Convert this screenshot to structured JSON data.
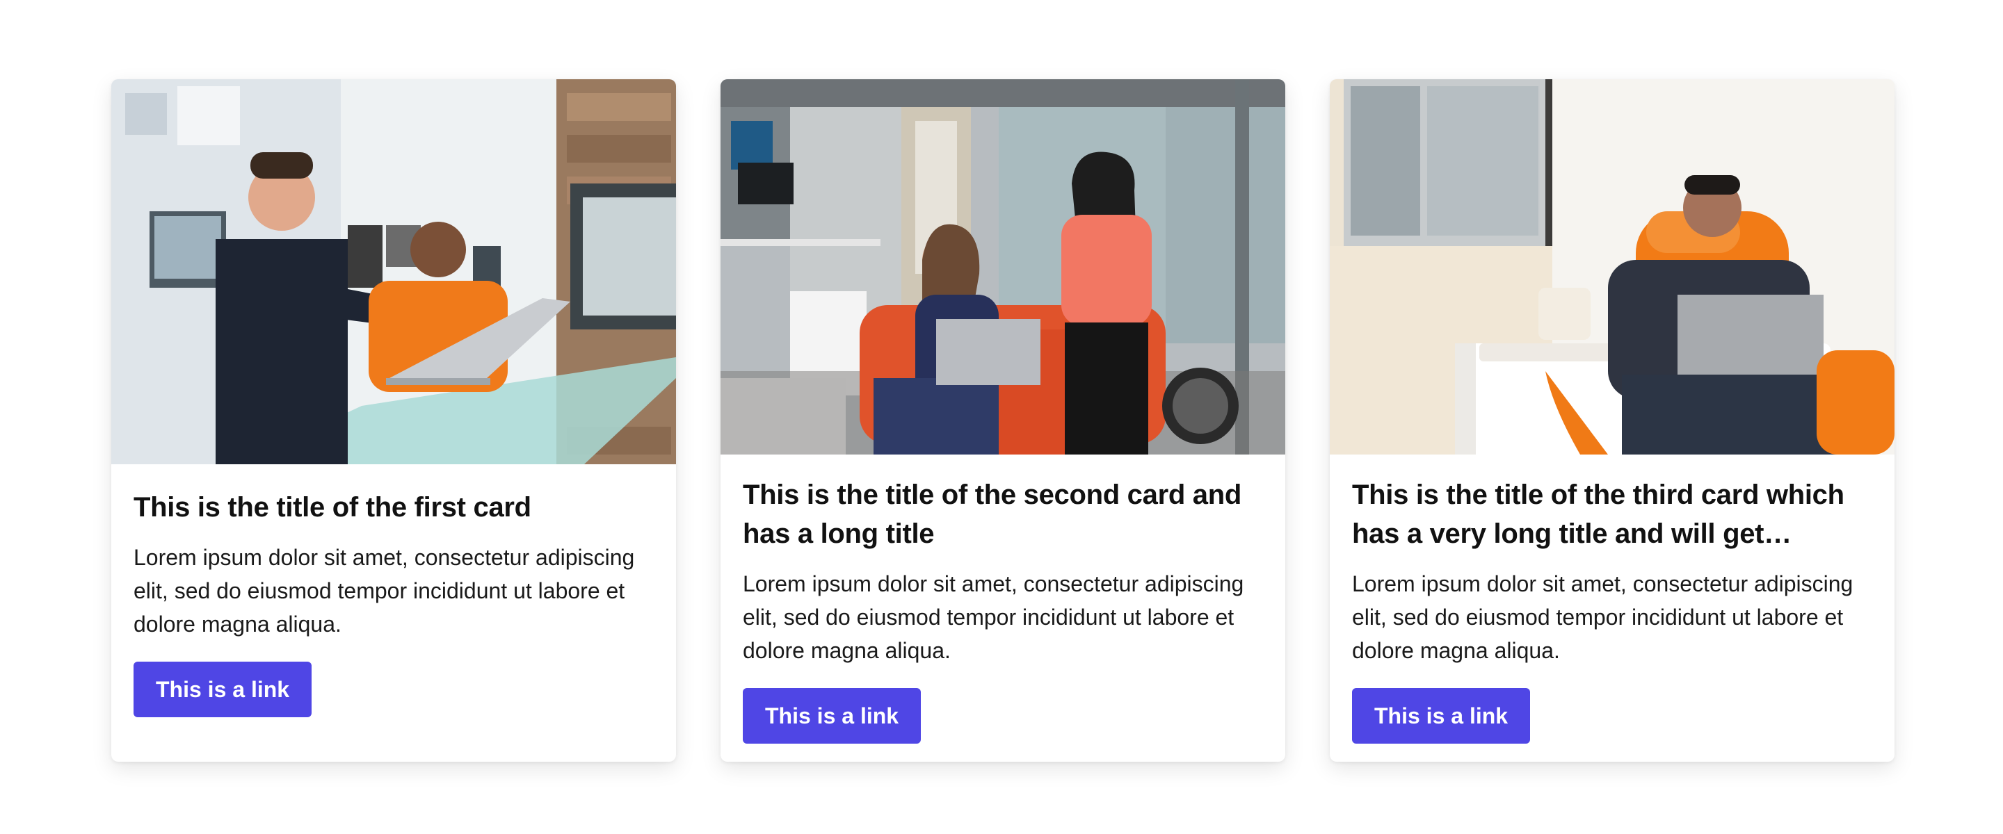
{
  "cards": [
    {
      "title": "This is the title of the first card",
      "text": "Lorem ipsum dolor sit amet, consectetur adipiscing elit, sed do eiusmod tempor incididunt ut labore et dolore magna aliqua.",
      "link_label": "This is a link",
      "image_alt": "two men at a desk looking at a laptop"
    },
    {
      "title": "This is the title of the second card and has a long title",
      "text": "Lorem ipsum dolor sit amet, consectetur adipiscing elit, sed do eiusmod tempor incididunt ut labore et dolore magna aliqua.",
      "link_label": "This is a link",
      "image_alt": "two women on an orange sofa with a laptop"
    },
    {
      "title": "This is the title of the third card which has a very long title and will get truncated",
      "text": "Lorem ipsum dolor sit amet, consectetur adipiscing elit, sed do eiusmod tempor incididunt ut labore et dolore magna aliqua.",
      "link_label": "This is a link",
      "image_alt": "man in orange chair working on laptop"
    }
  ],
  "colors": {
    "button": "#4f46e5",
    "button_text": "#ffffff"
  }
}
